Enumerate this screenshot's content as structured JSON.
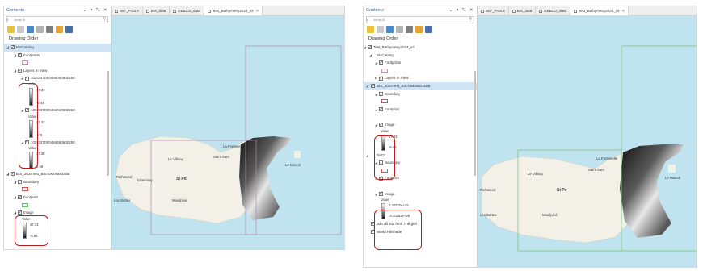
{
  "panels": [
    {
      "contents": {
        "title": "Contents",
        "controls": "⌄ ▾ ⤡ ✕",
        "search_placeholder": "Search",
        "drawing_order": "Drawing Order"
      },
      "tree": {
        "bis_catalog": "BisCatalog",
        "footprints": "Footprints",
        "layers_in_view": "Layers In View",
        "raster_items": [
          {
            "name": "102GB7D00494040600250",
            "value_label": "Value",
            "max": "47.37",
            "min": "-2.44"
          },
          {
            "name": "102GB7D00494040600260",
            "value_label": "Value",
            "max": "47.47",
            "min": "-7.5"
          },
          {
            "name": "102GB7D00494550600250",
            "value_label": "Value",
            "max": "37.39",
            "min": "2.59"
          }
        ],
        "mosaic_dataset": "BIS_2024Test_BISToMosaicData",
        "boundary": "Boundary",
        "footprint": "Footprint",
        "image": "Image",
        "image_value_label": "Value",
        "image_max": "47.33",
        "image_min": "-6.96"
      },
      "tabs": [
        {
          "label": "S57_Pro3.4",
          "active": false
        },
        {
          "label": "BIS_data",
          "active": false
        },
        {
          "label": "GEBCO_data",
          "active": false
        },
        {
          "label": "Test_Bathymetry2024_v2",
          "active": true
        }
      ],
      "places": {
        "richmond": "Richmond",
        "le_villocq": "Le Villocq",
        "guernsey": "Guernsey",
        "st_peter": "St Pel",
        "saint_sampson": "Saint Sam",
        "la_fontenelle": "La Fontenelle",
        "le_manoir": "Le Manoir",
        "les_buttes": "Les Buttes",
        "mouilpied": "Mouilpied"
      }
    },
    {
      "contents": {
        "title": "Contents",
        "controls": "⌄ ▾ ⤡ ✕",
        "search_placeholder": "Search",
        "drawing_order": "Drawing Order"
      },
      "tree": {
        "map_name": "Test_Bathymetry2024_v2",
        "bis_catalog": "BisCatalog",
        "footprints": "Footprints",
        "layers_in_view": "Layers In View",
        "mosaic_dataset": "BIS_2024Test_BISToMosaicData",
        "boundary": "Boundary",
        "footprint": "Footprint",
        "image": "Image",
        "value_label": "Value",
        "image_max": "47.33",
        "image_min": "-6.96",
        "bisdi": "BisDI",
        "boundary2": "Boundary",
        "footprint2": "Footprint",
        "image2": "Image",
        "value_label2": "Value",
        "image2_max": "3.40282e+38",
        "image2_min": "-3.40282e+38",
        "basemap": "Bản đồ Địa hình Thế giới",
        "hillshade": "World Hillshade"
      },
      "tabs": [
        {
          "label": "S57_Pro3.4",
          "active": false
        },
        {
          "label": "BIS_data",
          "active": false
        },
        {
          "label": "GEBCO_data",
          "active": false
        },
        {
          "label": "Test_Bathymetry2024_v2",
          "active": true
        }
      ],
      "places": {
        "richmond": "Richmond",
        "le_villocq": "Le Villocq",
        "st_peter": "St Pe",
        "saint_sampson": "Saint Sam",
        "la_fontenelle": "La Fontenelle",
        "le_manoir": "Le Manoir",
        "les_buttes": "Les Buttes",
        "mouilpied": "Mouilpied"
      }
    }
  ],
  "colors": {
    "title_blue": "#2b6cb5",
    "highlight_red": "#b81c1c",
    "footprint_purple": "#c8a0c8",
    "footprint_green": "#7fc27f",
    "selection_blue": "#cfe3f7",
    "sea": "#bfe3ef",
    "land": "#f3f0e8"
  },
  "icons": [
    "funnel-icon",
    "search-icon",
    "list-by-drawing-order-icon",
    "list-by-source-icon",
    "list-by-selection-icon",
    "list-by-editing-icon",
    "list-by-snapping-icon",
    "list-by-labeling-icon",
    "list-by-perspective-icon"
  ]
}
